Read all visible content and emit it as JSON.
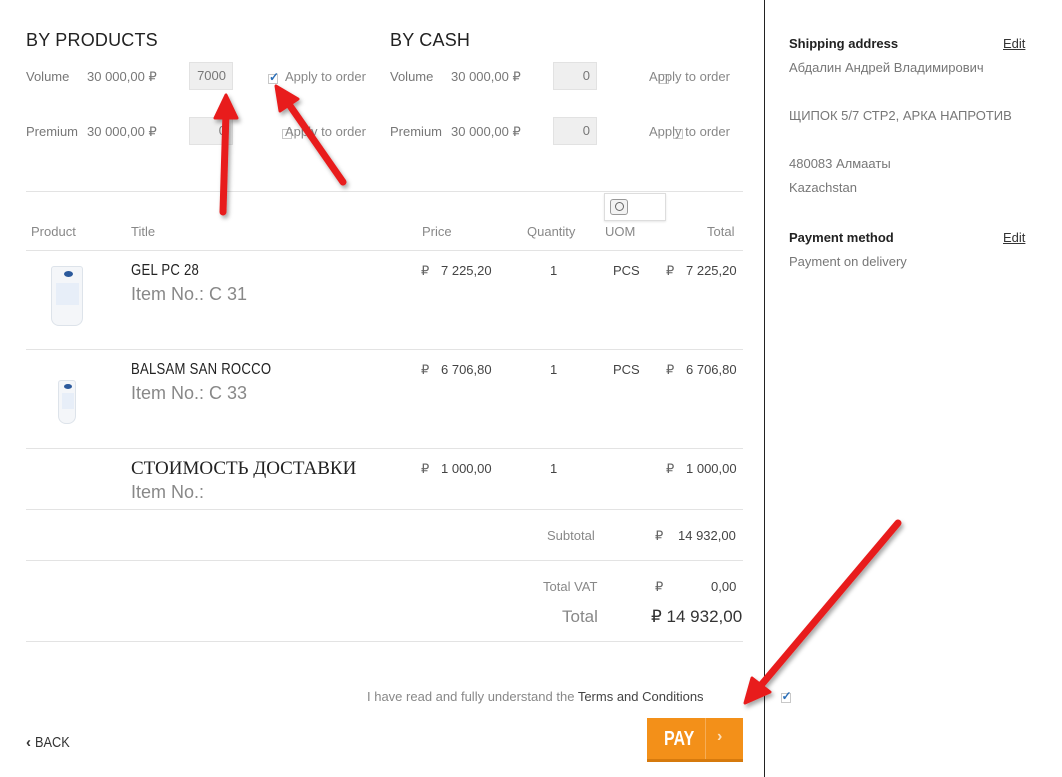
{
  "by_products": {
    "heading": "BY PRODUCTS",
    "volume_label": "Volume",
    "volume_amount": "30 000,00 ₽",
    "volume_input": "7000",
    "volume_apply": "Apply to order",
    "volume_checked": true,
    "premium_label": "Premium",
    "premium_amount": "30 000,00 ₽",
    "premium_input": "0",
    "premium_apply": "Apply to order",
    "premium_checked": false
  },
  "by_cash": {
    "heading": "BY CASH",
    "volume_label": "Volume",
    "volume_amount": "30 000,00 ₽",
    "volume_input": "0",
    "volume_apply": "Apply to order",
    "volume_checked": false,
    "premium_label": "Premium",
    "premium_amount": "30 000,00 ₽",
    "premium_input": "0",
    "premium_apply": "Apply to order",
    "premium_checked": false
  },
  "table": {
    "headers": {
      "product": "Product",
      "title": "Title",
      "price": "Price",
      "quantity": "Quantity",
      "uom": "UOM",
      "total": "Total"
    },
    "rows": [
      {
        "title": "GEL PC 28",
        "item_no": "Item No.: C 31",
        "currency": "₽",
        "price": "7 225,20",
        "quantity": "1",
        "uom": "PCS",
        "total_currency": "₽",
        "total": "7 225,20"
      },
      {
        "title": "BALSAM SAN ROCCO",
        "item_no": "Item No.: C 33",
        "currency": "₽",
        "price": "6 706,80",
        "quantity": "1",
        "uom": "PCS",
        "total_currency": "₽",
        "total": "6 706,80"
      },
      {
        "title": "СТОИМОСТЬ ДОСТАВКИ",
        "item_no": "Item No.:",
        "currency": "₽",
        "price": "1 000,00",
        "quantity": "1",
        "uom": "",
        "total_currency": "₽",
        "total": "1 000,00"
      }
    ]
  },
  "summary": {
    "subtotal_label": "Subtotal",
    "subtotal_currency": "₽",
    "subtotal_value": "14 932,00",
    "vat_label": "Total VAT",
    "vat_currency": "₽",
    "vat_value": "0,00",
    "total_label": "Total",
    "total_value": "₽ 14 932,00"
  },
  "terms": {
    "prefix": "I have read and fully understand the",
    "link": "Terms and Conditions",
    "checked": true
  },
  "buttons": {
    "back": "BACK",
    "pay": "PAY"
  },
  "sidebar": {
    "shipping_heading": "Shipping address",
    "shipping_edit": "Edit",
    "name": "Абдалин Андрей Владимирович",
    "street": "ЩИПОК 5/7 СТР2, АРКА НАПРОТИВ",
    "city": "480083 Алмааты",
    "country": "Kazachstan",
    "payment_heading": "Payment method",
    "payment_edit": "Edit",
    "payment_value": "Payment on delivery"
  },
  "colors": {
    "accent": "#f39019",
    "annotation_arrow": "#e81c1c"
  }
}
